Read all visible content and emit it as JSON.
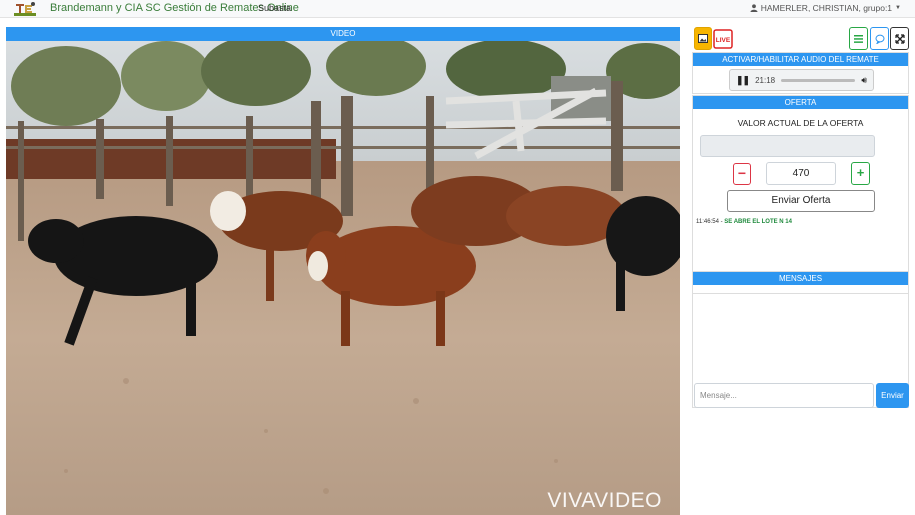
{
  "navbar": {
    "brand": "Brandemann y CIA SC Gestión de Remates Online",
    "link": "Subasta",
    "user": "HAMERLER, CHRISTIAN, grupo:1",
    "logo_icon": "logo-icon",
    "user_icon": "user-icon"
  },
  "video": {
    "header": "VIDEO",
    "watermark": "VIVAVIDEO"
  },
  "audio": {
    "title": "ACTIVAR/HABILITAR AUDIO DEL REMATE",
    "time": "21:18"
  },
  "oferta": {
    "title": "OFERTA",
    "valor_label": "VALOR ACTUAL DE LA OFERTA",
    "current_value": "",
    "minus": "−",
    "plus": "+",
    "quantity": "470",
    "submit": "Enviar Oferta",
    "log": [
      {
        "time": "11:46:54",
        "sep": " - ",
        "msg": "SE ABRE EL LOTE N 14"
      }
    ]
  },
  "mensajes": {
    "title": "MENSAJES",
    "placeholder": "Mensaje...",
    "send": "Enviar"
  },
  "colors": {
    "accent": "#2d96f0",
    "brand_text": "#3a7d3a",
    "log_green": "#1f8a3d",
    "minus_red": "#dc3545",
    "plus_green": "#28a745",
    "gallery_yellow": "#f7b500"
  }
}
